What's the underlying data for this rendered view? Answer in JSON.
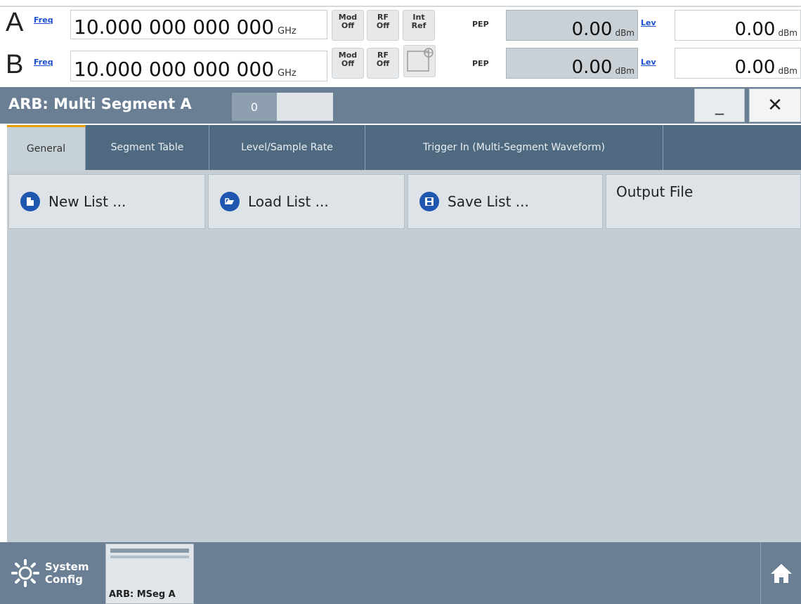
{
  "status": {
    "rows": [
      {
        "channel": "A",
        "freq_label": "Freq",
        "freq_value": "10.000 000 000 000",
        "freq_unit": "GHz",
        "mod": "Mod\nOff",
        "rf": "RF\nOff",
        "pep_label": "PEP",
        "pep_value": "0.00",
        "pep_unit": "dBm",
        "lev_label": "Lev",
        "lev_value": "0.00",
        "lev_unit": "dBm"
      },
      {
        "channel": "B",
        "freq_label": "Freq",
        "freq_value": "10.000 000 000 000",
        "freq_unit": "GHz",
        "mod": "Mod\nOff",
        "rf": "RF\nOff",
        "pep_label": "PEP",
        "pep_value": "0.00",
        "pep_unit": "dBm",
        "lev_label": "Lev",
        "lev_value": "0.00",
        "lev_unit": "dBm"
      }
    ],
    "int_ref": "Int\nRef"
  },
  "dialog": {
    "title": "ARB: Multi Segment A",
    "index": "0",
    "minimize": "_",
    "close": "✕",
    "tabs": [
      {
        "label": "General"
      },
      {
        "label": "Segment Table"
      },
      {
        "label": "Level/Sample Rate"
      },
      {
        "label": "Trigger In (Multi-Segment Waveform)"
      }
    ],
    "buttons": {
      "new_list": "New List ...",
      "load_list": "Load List ...",
      "save_list": "Save List ...",
      "output_file": "Output File"
    }
  },
  "taskbar": {
    "system_config": "System\nConfig",
    "thumb_label": "ARB: MSeg A"
  },
  "icons": {
    "new": "new-list-icon",
    "load": "load-list-icon",
    "save": "save-list-icon",
    "settings": "gear-icon",
    "home": "home-icon"
  },
  "colors": {
    "title_bar": "#6a7f93",
    "tab_bar": "#4f6a80",
    "content_bg": "#c4cdd4",
    "accent": "#e9a100",
    "icon_blue": "#1f57b0"
  }
}
